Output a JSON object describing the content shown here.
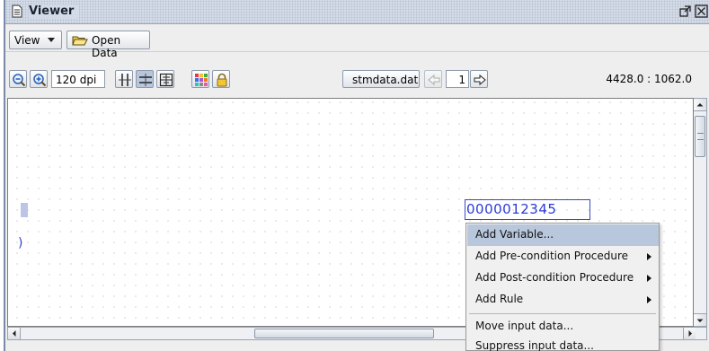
{
  "window": {
    "title": "Viewer"
  },
  "menubar": {
    "view_label": "View",
    "open_data_label": "Open Data"
  },
  "toolbar": {
    "dpi": "120 dpi",
    "data_file": "stmdata.dat",
    "page": "1",
    "coordinates": "4428.0 : 1062.0"
  },
  "canvas": {
    "field_value": "0000012345"
  },
  "context_menu": {
    "items": [
      {
        "label": "Add Variable...",
        "highlighted": true,
        "submenu": false
      },
      {
        "label": "Add Pre-condition Procedure",
        "submenu": true
      },
      {
        "label": "Add Post-condition Procedure",
        "submenu": true
      },
      {
        "label": "Add Rule",
        "submenu": true
      },
      {
        "label": "Move input data...",
        "submenu": false
      },
      {
        "label": "Suppress input data...",
        "submenu": false
      }
    ]
  },
  "colors": {
    "title_bar": "#d4dbe8",
    "field_text": "#2a3bd6",
    "menu_highlight": "#b9c7dc"
  },
  "icons": {
    "title": "document-icon",
    "maximize": "maximize-icon",
    "close": "close-icon",
    "open": "folder-open-icon",
    "zoom_out": "zoom-out-icon",
    "zoom_in": "zoom-in-icon",
    "layout_columns": "column-layout-icon",
    "layout_rows": "row-layout-icon",
    "layout_fit": "fit-layout-icon",
    "palette": "color-palette-icon",
    "lock": "lock-icon",
    "prev": "arrow-left-icon",
    "next": "arrow-right-icon"
  }
}
